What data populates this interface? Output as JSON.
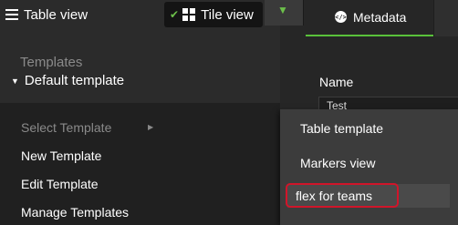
{
  "toolbar": {
    "table_view_label": "Table view",
    "tile_view_label": "Tile view"
  },
  "details_panel": {
    "tab_label": "Metadata",
    "name_label": "Name",
    "name_value": "Test"
  },
  "templates": {
    "heading": "Templates",
    "current": "Default template"
  },
  "template_menu": {
    "items": [
      {
        "label": "Select Template"
      },
      {
        "label": "New Template"
      },
      {
        "label": "Edit Template"
      },
      {
        "label": "Manage Templates"
      }
    ]
  },
  "template_submenu": {
    "items": [
      {
        "label": "Table template"
      },
      {
        "label": "Markers view"
      },
      {
        "label": "flex for teams"
      }
    ]
  },
  "colors": {
    "accent_green": "#59c13a",
    "highlight_red": "#d0152a"
  }
}
